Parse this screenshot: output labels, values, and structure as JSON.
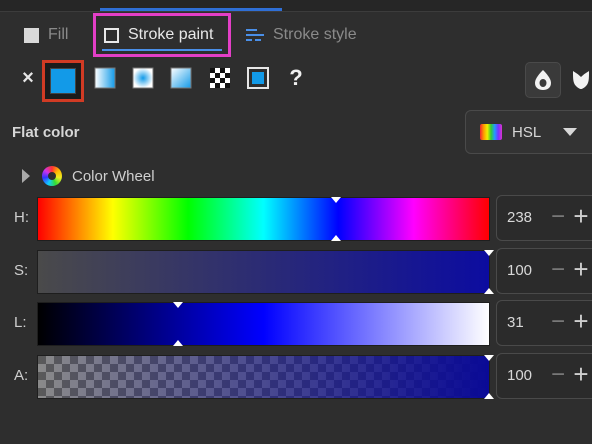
{
  "tabs": [
    {
      "label": "Fill",
      "active": false
    },
    {
      "label": "Stroke paint",
      "active": true
    },
    {
      "label": "Stroke style",
      "active": false
    }
  ],
  "paint_types": [
    {
      "name": "no-paint",
      "glyph": "×"
    },
    {
      "name": "flat-color",
      "selected": true
    },
    {
      "name": "linear-gradient"
    },
    {
      "name": "radial-gradient"
    },
    {
      "name": "mesh-gradient"
    },
    {
      "name": "pattern"
    },
    {
      "name": "swatch"
    },
    {
      "name": "unset",
      "glyph": "?"
    }
  ],
  "fill_rule_buttons": [
    "evenodd-icon",
    "nonzero-icon"
  ],
  "section_title": "Flat color",
  "color_mode": {
    "label": "HSL"
  },
  "color_wheel": {
    "label": "Color Wheel"
  },
  "sliders": [
    {
      "letter": "H:",
      "value": "238",
      "fraction": 0.66
    },
    {
      "letter": "S:",
      "value": "100",
      "fraction": 1.0
    },
    {
      "letter": "L:",
      "value": "31",
      "fraction": 0.31
    },
    {
      "letter": "A:",
      "value": "100",
      "fraction": 1.0
    }
  ],
  "colors": {
    "accent_blue": "#129ae8",
    "tab_highlight": "#e33fc7",
    "selection_border": "#d13b24",
    "current_color": "#0c0ca0"
  }
}
